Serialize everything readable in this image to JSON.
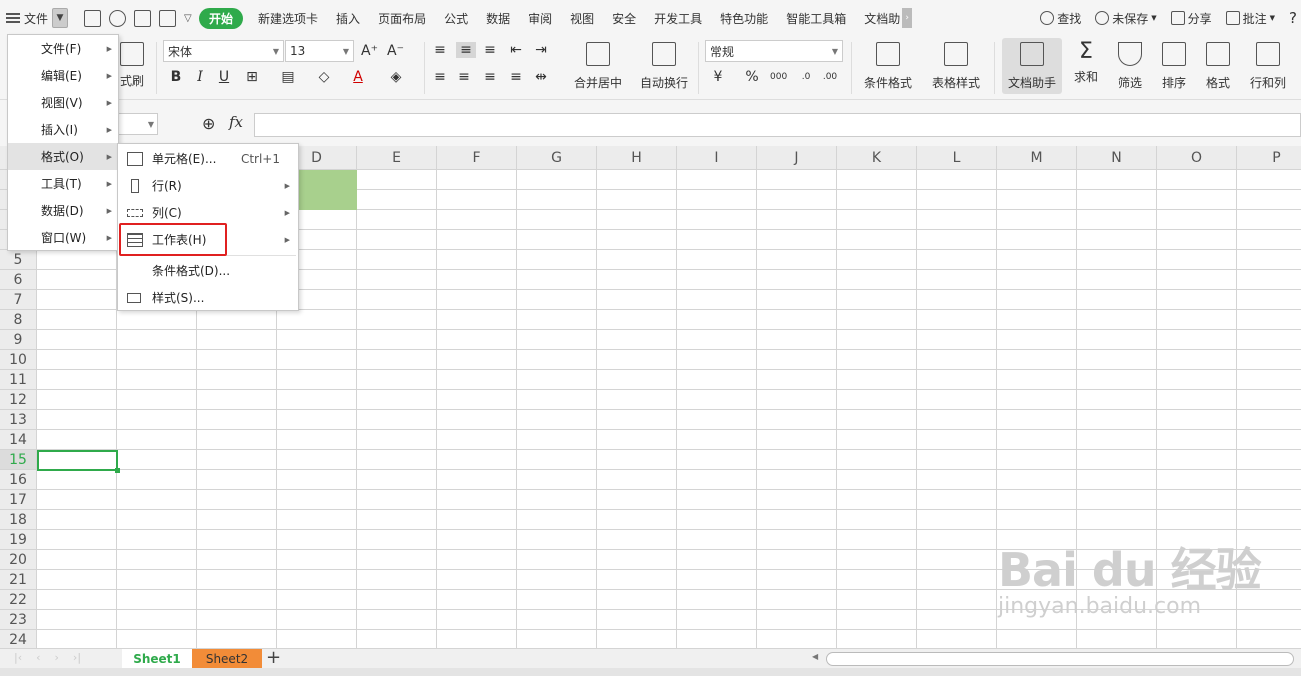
{
  "topbar": {
    "file_label": "文件",
    "tabs": [
      "开始",
      "新建选项卡",
      "插入",
      "页面布局",
      "公式",
      "数据",
      "审阅",
      "视图",
      "安全",
      "开发工具",
      "特色功能",
      "智能工具箱",
      "文档助"
    ],
    "search": "查找",
    "unsaved": "未保存",
    "share": "分享",
    "annotate": "批注"
  },
  "ribbon": {
    "format_painter": "式刷",
    "font_name": "宋体",
    "font_size": "13",
    "number_format": "常规",
    "merge_center": "合并居中",
    "wrap_text": "自动换行",
    "conditional_format": "条件格式",
    "table_style": "表格样式",
    "doc_assistant": "文档助手",
    "sum": "求和",
    "filter": "筛选",
    "sort": "排序",
    "format": "格式",
    "row_col": "行和列"
  },
  "columns": [
    "D",
    "E",
    "F",
    "G",
    "H",
    "I",
    "J",
    "K",
    "L",
    "M",
    "N",
    "O",
    "P"
  ],
  "rows": [
    "5",
    "6",
    "7",
    "8",
    "9",
    "10",
    "11",
    "12",
    "13",
    "14",
    "15",
    "16",
    "17",
    "18",
    "19",
    "20",
    "21",
    "22",
    "23",
    "24"
  ],
  "selected_row": "15",
  "main_menu": [
    {
      "label": "文件(F)"
    },
    {
      "label": "编辑(E)"
    },
    {
      "label": "视图(V)"
    },
    {
      "label": "插入(I)"
    },
    {
      "label": "格式(O)"
    },
    {
      "label": "工具(T)"
    },
    {
      "label": "数据(D)"
    },
    {
      "label": "窗口(W)"
    }
  ],
  "format_submenu": [
    {
      "label": "单元格(E)...",
      "shortcut": "Ctrl+1"
    },
    {
      "label": "行(R)"
    },
    {
      "label": "列(C)"
    },
    {
      "label": "工作表(H)"
    },
    {
      "label": "条件格式(D)..."
    },
    {
      "label": "样式(S)..."
    }
  ],
  "sheets": [
    "Sheet1",
    "Sheet2"
  ],
  "watermark": {
    "main": "Bai du 经验",
    "sub": "jingyan.baidu.com"
  },
  "colors": {
    "accent": "#2faa4b",
    "highlight": "#e02020",
    "sheet2_tab": "#f28c38",
    "green_cell": "#a8d08d"
  }
}
